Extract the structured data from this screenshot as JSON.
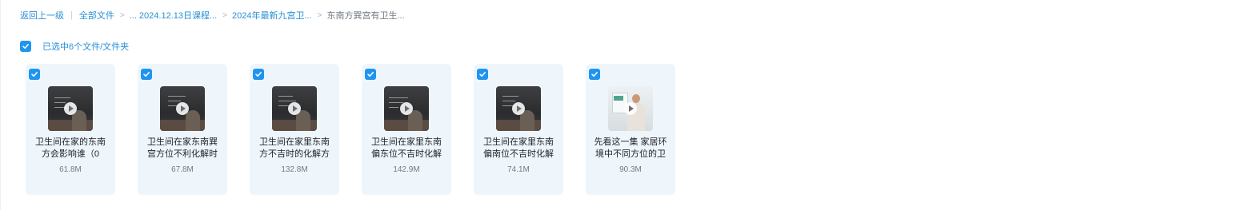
{
  "breadcrumb": {
    "back": "返回上一级",
    "items": [
      "全部文件",
      "... 2024.12.13日课程...",
      "2024年最新九宫卫...",
      "东南方巽宫有卫生..."
    ]
  },
  "selection": {
    "checked": true,
    "label": "已选中6个文件/文件夹"
  },
  "files": [
    {
      "title": "卫生间在家的东南方会影响谁（0",
      "size": "61.8M",
      "thumb": "classroom-video",
      "checked": true
    },
    {
      "title": "卫生间在家东南巽宫方位不利化解时",
      "size": "67.8M",
      "thumb": "classroom-video",
      "checked": true
    },
    {
      "title": "卫生间在家里东南方不吉时的化解方",
      "size": "132.8M",
      "thumb": "classroom-video",
      "checked": true
    },
    {
      "title": "卫生间在家里东南偏东位不吉时化解",
      "size": "142.9M",
      "thumb": "classroom-video",
      "checked": true
    },
    {
      "title": "卫生间在家里东南偏南位不吉时化解",
      "size": "74.1M",
      "thumb": "classroom-video",
      "checked": true
    },
    {
      "title": "先看这一集 家居环境中不同方位的卫",
      "size": "90.3M",
      "thumb": "room-video",
      "checked": true
    }
  ],
  "icons": {
    "checkbox": "checkmark-icon",
    "separator": "chevron-right-icon",
    "video": "play-icon"
  },
  "colors": {
    "accent": "#1e96f0",
    "link": "#2a8fd6",
    "card_bg": "#eef6fc"
  }
}
